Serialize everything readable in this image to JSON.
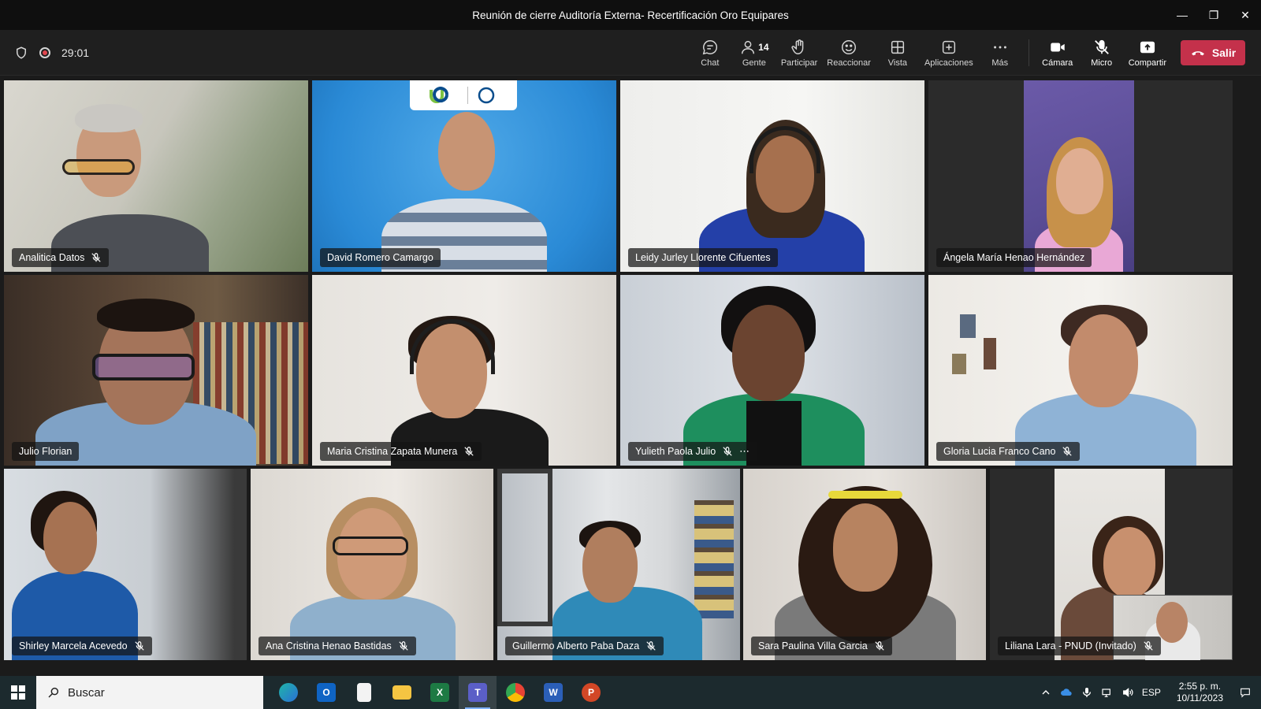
{
  "window": {
    "title": "Reunión de cierre Auditoría Externa- Recertificación Oro Equipares"
  },
  "meeting": {
    "elapsed": "29:01",
    "people_count": "14"
  },
  "toolbar": {
    "chat": "Chat",
    "people": "Gente",
    "raise": "Participar",
    "react": "Reaccionar",
    "view": "Vista",
    "apps": "Aplicaciones",
    "more": "Más",
    "camera": "Cámara",
    "mic": "Micro",
    "share": "Compartir",
    "leave": "Salir"
  },
  "participants": [
    {
      "name": "Analitica Datos",
      "muted": true
    },
    {
      "name": "David Romero Camargo",
      "muted": false
    },
    {
      "name": "Leidy Jurley Llorente Cifuentes",
      "muted": false
    },
    {
      "name": "Ángela María Henao Hernández",
      "muted": false
    },
    {
      "name": "Julio Florian",
      "muted": false
    },
    {
      "name": "Maria Cristina Zapata Munera",
      "muted": true
    },
    {
      "name": "Yulieth Paola Julio",
      "muted": true
    },
    {
      "name": "Gloria Lucia Franco Cano",
      "muted": true
    },
    {
      "name": "Shirley Marcela Acevedo",
      "muted": true
    },
    {
      "name": "Ana Cristina Henao Bastidas",
      "muted": true
    },
    {
      "name": "Guillermo Alberto Paba Daza",
      "muted": true
    },
    {
      "name": "Sara Paulina Villa Garcia",
      "muted": true
    },
    {
      "name": "Liliana Lara - PNUD (Invitado)",
      "muted": true
    }
  ],
  "taskbar": {
    "search_placeholder": "Buscar",
    "language": "ESP",
    "time": "2:55 p. m.",
    "date": "10/11/2023"
  },
  "colors": {
    "leave_button": "#c4314b",
    "toolbar_bg": "#1f1f1f",
    "taskbar_bg": "#1c2a2e"
  }
}
